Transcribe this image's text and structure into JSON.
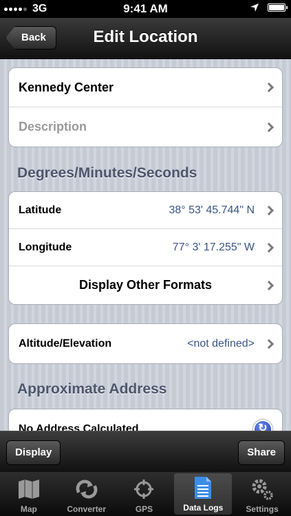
{
  "status": {
    "carrier": "3G",
    "time": "9:41 AM"
  },
  "nav": {
    "back_label": "Back",
    "title": "Edit Location"
  },
  "location": {
    "name": "Kennedy Center",
    "description_placeholder": "Description"
  },
  "dms": {
    "header": "Degrees/Minutes/Seconds",
    "latitude_label": "Latitude",
    "latitude_value": "38° 53' 45.744\" N",
    "longitude_label": "Longitude",
    "longitude_value": "77° 3' 17.255\" W",
    "other_formats_label": "Display Other Formats"
  },
  "altitude": {
    "label": "Altitude/Elevation",
    "value": "<not defined>"
  },
  "address": {
    "header": "Approximate Address",
    "value": "No Address Calculated"
  },
  "toolbar": {
    "display_label": "Display",
    "share_label": "Share"
  },
  "tabs": [
    {
      "label": "Map",
      "icon": "map-icon"
    },
    {
      "label": "Converter",
      "icon": "converter-icon"
    },
    {
      "label": "GPS",
      "icon": "gps-icon"
    },
    {
      "label": "Data Logs",
      "icon": "data-logs-icon",
      "active": true
    },
    {
      "label": "Settings",
      "icon": "settings-icon"
    }
  ],
  "colors": {
    "accent_value": "#385487",
    "section_header": "#4c566c",
    "active_tab_icon": "#3a8ee6"
  }
}
